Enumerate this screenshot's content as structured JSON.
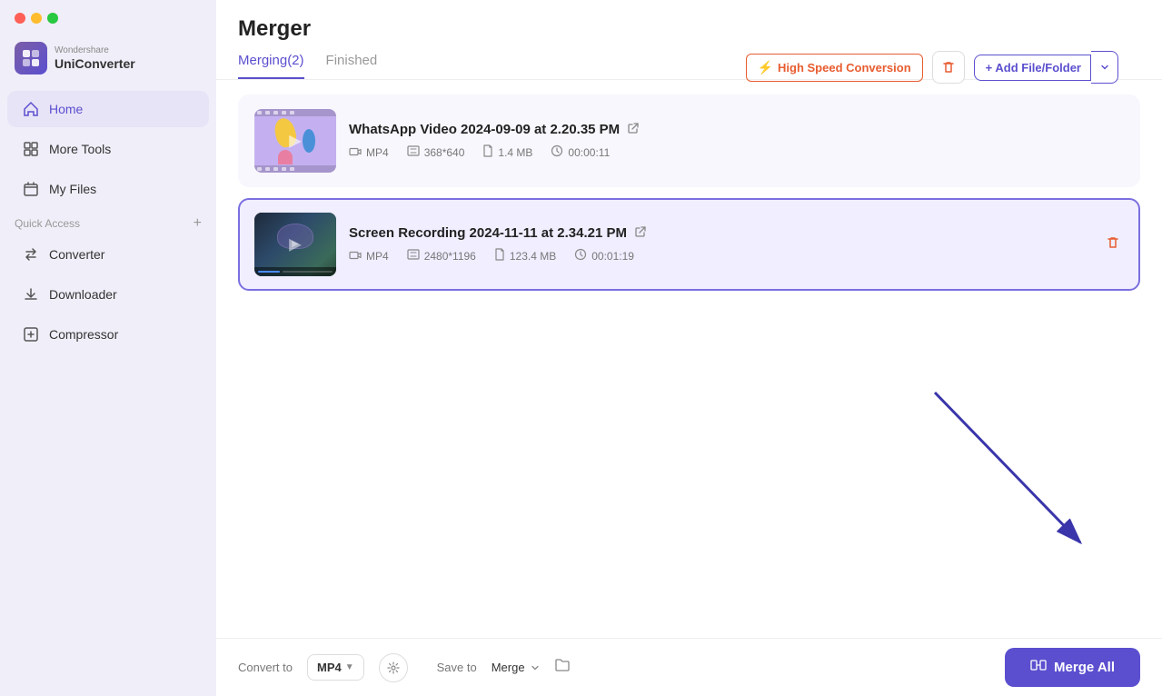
{
  "app": {
    "name": "UniConverter",
    "brand": "Wondershare",
    "logo_letter": "U"
  },
  "traffic_lights": {
    "close": "#ff5f57",
    "minimize": "#febc2e",
    "maximize": "#28c840"
  },
  "sidebar": {
    "nav_items": [
      {
        "id": "home",
        "label": "Home",
        "active": true
      },
      {
        "id": "more-tools",
        "label": "More Tools",
        "active": false
      },
      {
        "id": "my-files",
        "label": "My Files",
        "active": false
      }
    ],
    "quick_access_label": "Quick Access",
    "quick_access_items": [
      {
        "id": "converter",
        "label": "Converter"
      },
      {
        "id": "downloader",
        "label": "Downloader"
      },
      {
        "id": "compressor",
        "label": "Compressor"
      }
    ]
  },
  "page": {
    "title": "Merger",
    "tabs": [
      {
        "id": "merging",
        "label": "Merging(2)",
        "active": true
      },
      {
        "id": "finished",
        "label": "Finished",
        "active": false
      }
    ]
  },
  "toolbar": {
    "high_speed_label": "High Speed Conversion",
    "add_file_label": "+ Add File/Folder"
  },
  "files": [
    {
      "id": "file1",
      "name": "WhatsApp Video 2024-09-09 at 2.20.35 PM",
      "format": "MP4",
      "resolution": "368*640",
      "size": "1.4 MB",
      "duration": "00:00:11",
      "selected": false,
      "thumb_type": "whatsapp"
    },
    {
      "id": "file2",
      "name": "Screen Recording 2024-11-11 at 2.34.21 PM",
      "format": "MP4",
      "resolution": "2480*1196",
      "size": "123.4 MB",
      "duration": "00:01:19",
      "selected": true,
      "thumb_type": "screen"
    }
  ],
  "bottom_bar": {
    "convert_to_label": "Convert to",
    "format_value": "MP4",
    "save_to_label": "Save to",
    "save_location": "Merge",
    "merge_all_label": "Merge All"
  },
  "colors": {
    "accent": "#5b4fcf",
    "danger": "#e85c30",
    "sidebar_bg": "#f0eef8",
    "active_nav": "#e8e4f7"
  }
}
